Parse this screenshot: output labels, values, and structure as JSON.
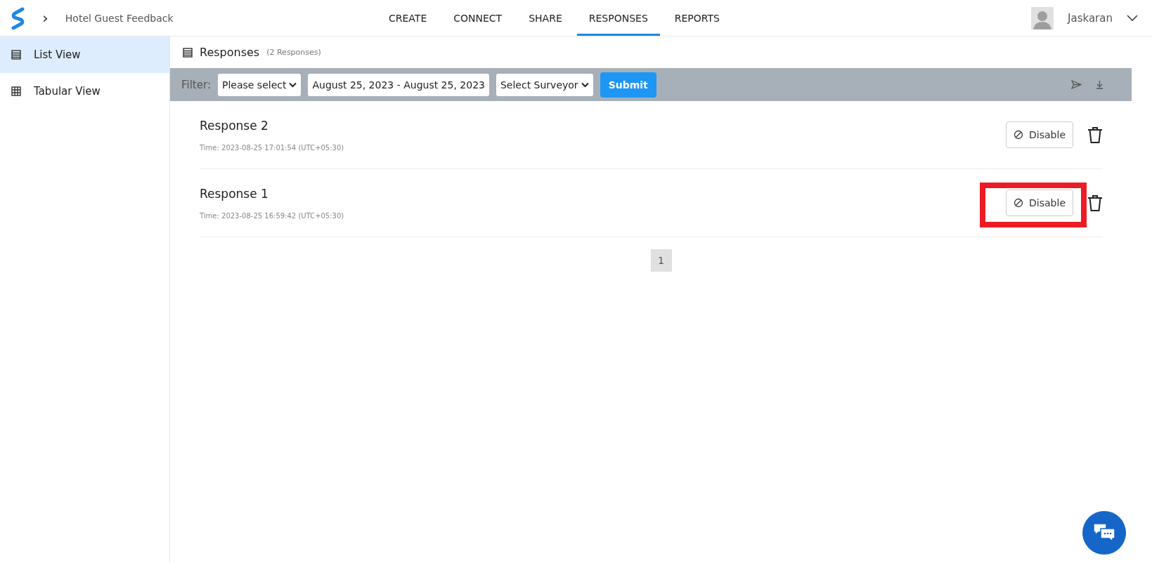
{
  "header": {
    "breadcrumb": "›",
    "survey_title": "Hotel Guest Feedback",
    "tabs": [
      {
        "label": "CREATE",
        "selected": false
      },
      {
        "label": "CONNECT",
        "selected": false
      },
      {
        "label": "SHARE",
        "selected": false
      },
      {
        "label": "RESPONSES",
        "selected": true
      },
      {
        "label": "REPORTS",
        "selected": false
      }
    ],
    "user": {
      "name": "Jaskaran"
    }
  },
  "sidebar": {
    "items": [
      {
        "label": "List View",
        "selected": true,
        "kind": "list"
      },
      {
        "label": "Tabular View",
        "selected": false,
        "kind": "table"
      }
    ]
  },
  "panel": {
    "title": "Responses",
    "count": "(2 Responses)"
  },
  "filter": {
    "label": "Filter:",
    "select": "Please select",
    "date_range": "August 25, 2023 - August 25, 2023",
    "surveyor": "Select Surveyor",
    "submit": "Submit"
  },
  "responses": [
    {
      "title": "Response 2",
      "time": "Time: 2023-08-25 17:01:54 (UTC+05:30)",
      "action": "Disable",
      "highlighted": false
    },
    {
      "title": "Response 1",
      "time": "Time: 2023-08-25 16:59:42 (UTC+05:30)",
      "action": "Disable",
      "highlighted": true
    }
  ],
  "pagination": [
    {
      "label": "1",
      "selected": true
    }
  ]
}
